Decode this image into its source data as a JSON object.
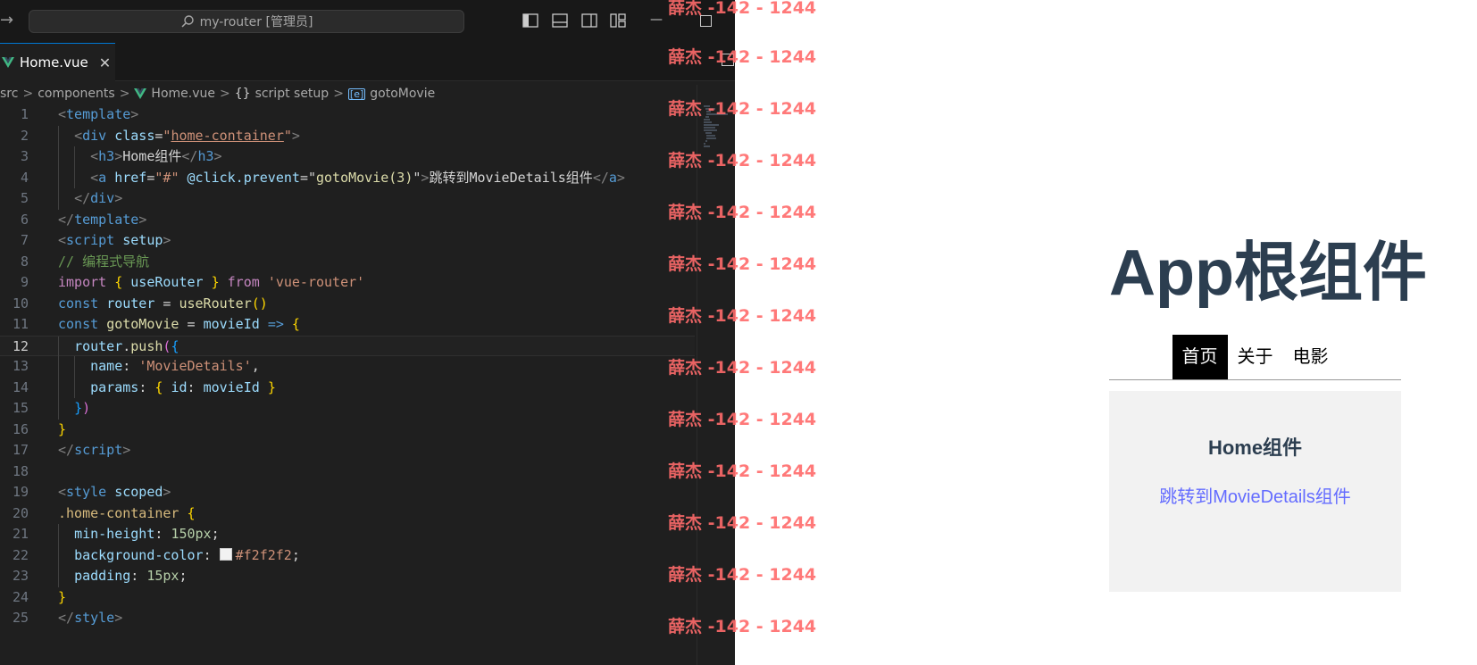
{
  "editor": {
    "title_search": "my-router [管理员]",
    "tab": {
      "label": "Home.vue",
      "close": "✕"
    },
    "breadcrumb": {
      "items": [
        "src",
        "components",
        "Home.vue",
        "script setup",
        "gotoMovie"
      ],
      "separator": ">",
      "brace": "{}",
      "symbol_glyph": "[e]"
    },
    "line_numbers": [
      "1",
      "2",
      "3",
      "4",
      "5",
      "6",
      "7",
      "8",
      "9",
      "10",
      "11",
      "12",
      "13",
      "14",
      "15",
      "16",
      "17",
      "18",
      "19",
      "20",
      "21",
      "22",
      "23",
      "24",
      "25"
    ],
    "active_line": "12",
    "code": {
      "l2_class_value": "home-container",
      "l3_text": "Home组件",
      "l4_href": "#",
      "l4_handler": "gotoMovie(3)",
      "l4_text": "跳转到MovieDetails组件",
      "l8_comment": "// 编程式导航",
      "l9_module": "'vue-router'",
      "l13_name": "'MovieDetails'",
      "l21_value": "150px",
      "l22_value": "#f2f2f2",
      "l23_value": "15px"
    },
    "colors": {
      "background": "#1f1f1f",
      "accent": "#0078d4"
    }
  },
  "watermark": {
    "text": "薛杰 -142 - 1244",
    "color": "#ff6b6b"
  },
  "browser": {
    "app_title": "App根组件",
    "nav": [
      {
        "label": "首页",
        "active": true
      },
      {
        "label": "关于",
        "active": false
      },
      {
        "label": "电影",
        "active": false
      }
    ],
    "home": {
      "title": "Home组件",
      "link": "跳转到MovieDetails组件",
      "background": "#f2f2f2"
    }
  }
}
